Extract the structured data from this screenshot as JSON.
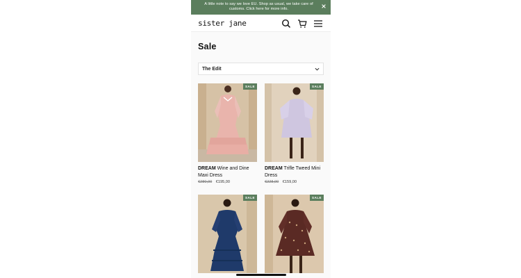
{
  "announcement": {
    "text": "A little note to say we love EU. Shop as usual, we take care of customs. Click here for more info."
  },
  "header": {
    "logo": "sister jane",
    "icons": [
      "search-icon",
      "cart-icon",
      "menu-icon"
    ]
  },
  "page": {
    "title": "Sale"
  },
  "filter": {
    "selected": "The Edit"
  },
  "products": [
    {
      "brand": "DREAM",
      "name": "Wine and Dine Maxi Dress",
      "old_price": "€280,00",
      "price": "€195,00",
      "badge": "SALE"
    },
    {
      "brand": "DREAM",
      "name": "Trifle Tweed Mini Dress",
      "old_price": "€228,00",
      "price": "€159,00",
      "badge": "SALE"
    },
    {
      "brand": "",
      "name": "",
      "old_price": "",
      "price": "",
      "badge": "SALE"
    },
    {
      "brand": "",
      "name": "",
      "old_price": "",
      "price": "",
      "badge": "SALE"
    }
  ],
  "colors": {
    "accent": "#5b7e5d"
  }
}
